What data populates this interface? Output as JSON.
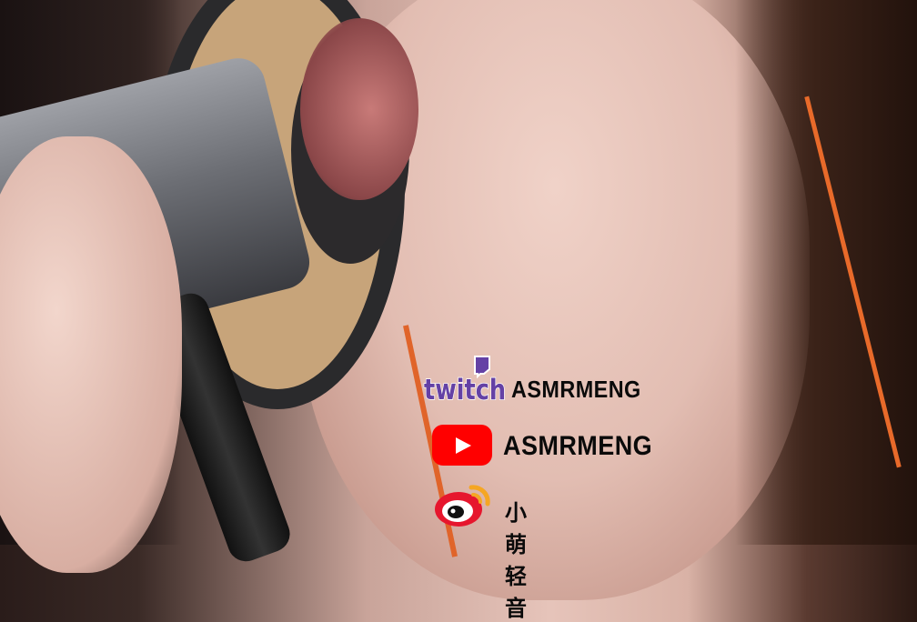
{
  "overlay": {
    "twitch": {
      "logo_text": "twitch",
      "handle": "ASMRMENG",
      "color": "#6441a5"
    },
    "youtube": {
      "handle": "ASMRMENG",
      "color": "#ff0000"
    },
    "weibo": {
      "handle": "小萌轻音",
      "color": "#e6162d"
    }
  }
}
